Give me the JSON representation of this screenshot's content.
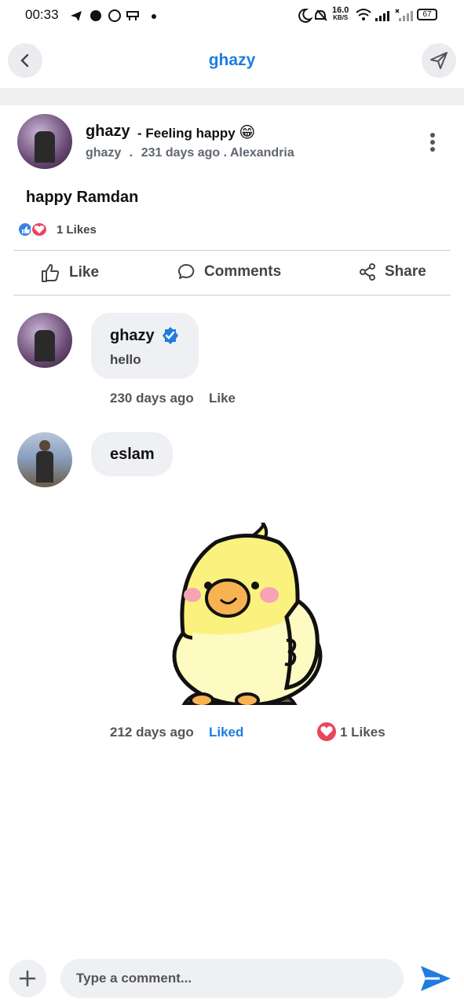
{
  "status_bar": {
    "time": "00:33",
    "net_speed": "16.0",
    "net_unit": "KB/S",
    "battery": "67"
  },
  "header": {
    "title": "ghazy"
  },
  "post": {
    "author": "ghazy",
    "feeling": "- Feeling happy",
    "feeling_emoji": "😁",
    "sub_user": "ghazy",
    "sub_sep": ".",
    "time_location": "231 days ago . Alexandria",
    "text": "happy Ramdan",
    "likes_count": "1 Likes"
  },
  "actions": {
    "like": "Like",
    "comments": "Comments",
    "share": "Share"
  },
  "comments": [
    {
      "name": "ghazy",
      "text": "hello",
      "time": "230 days ago",
      "like_label": "Like"
    },
    {
      "name": "eslam",
      "time": "212 days ago",
      "like_label": "Liked",
      "likes": "1 Likes"
    }
  ],
  "composer": {
    "placeholder": "Type a comment..."
  },
  "colors": {
    "accent": "#1f7ce0",
    "like_red": "#e8465a",
    "bubble": "#eef0f3"
  }
}
